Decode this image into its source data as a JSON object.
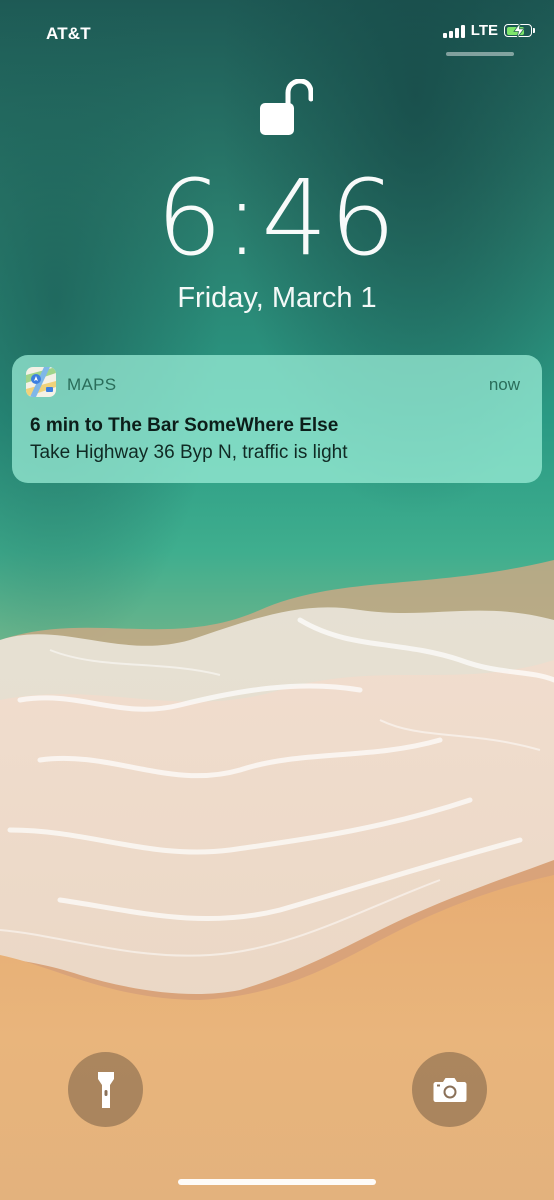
{
  "status_bar": {
    "carrier": "AT&T",
    "network": "LTE",
    "signal_bars": 4,
    "battery_level": 0.8,
    "charging": true,
    "battery_color": "#7de56b"
  },
  "lock_screen": {
    "lock_icon": "unlocked-padlock-icon",
    "time": "6:46",
    "date": "Friday, March 1"
  },
  "notification": {
    "app_icon": "maps-app-icon",
    "app_name": "MAPS",
    "time": "now",
    "title": "6 min to The Bar SomeWhere Else",
    "body": "Take Highway 36 Byp N, traffic is light"
  },
  "quick_actions": {
    "left_icon": "flashlight-icon",
    "right_icon": "camera-icon"
  }
}
